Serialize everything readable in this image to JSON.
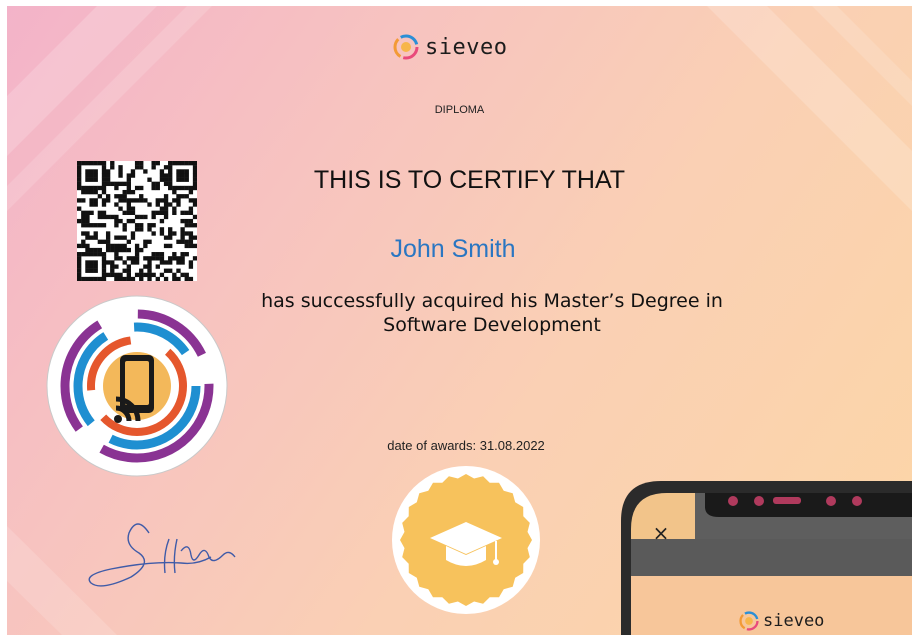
{
  "brand": {
    "name": "sieveo"
  },
  "certificate": {
    "heading": "DIPLOMA",
    "certify": "THIS IS TO CERTIFY THAT",
    "recipient": "John Smith",
    "description_line1": "has successfully acquired his Master’s Degree in",
    "description_line2": "Software Development",
    "date": "date of awards: 31.08.2022"
  },
  "phone_overlay": {
    "close_symbol": "×",
    "brand": "sieveo"
  },
  "colors": {
    "recipient": "#2a76c2",
    "seal": "#f7c25c",
    "badge_purple": "#8a3393",
    "badge_blue": "#1f8fd1",
    "badge_orange": "#e5572d"
  },
  "icons": [
    "sieveo-logo-icon",
    "qr-code",
    "mobile-badge-icon",
    "graduation-cap-icon",
    "signature",
    "close-icon"
  ]
}
